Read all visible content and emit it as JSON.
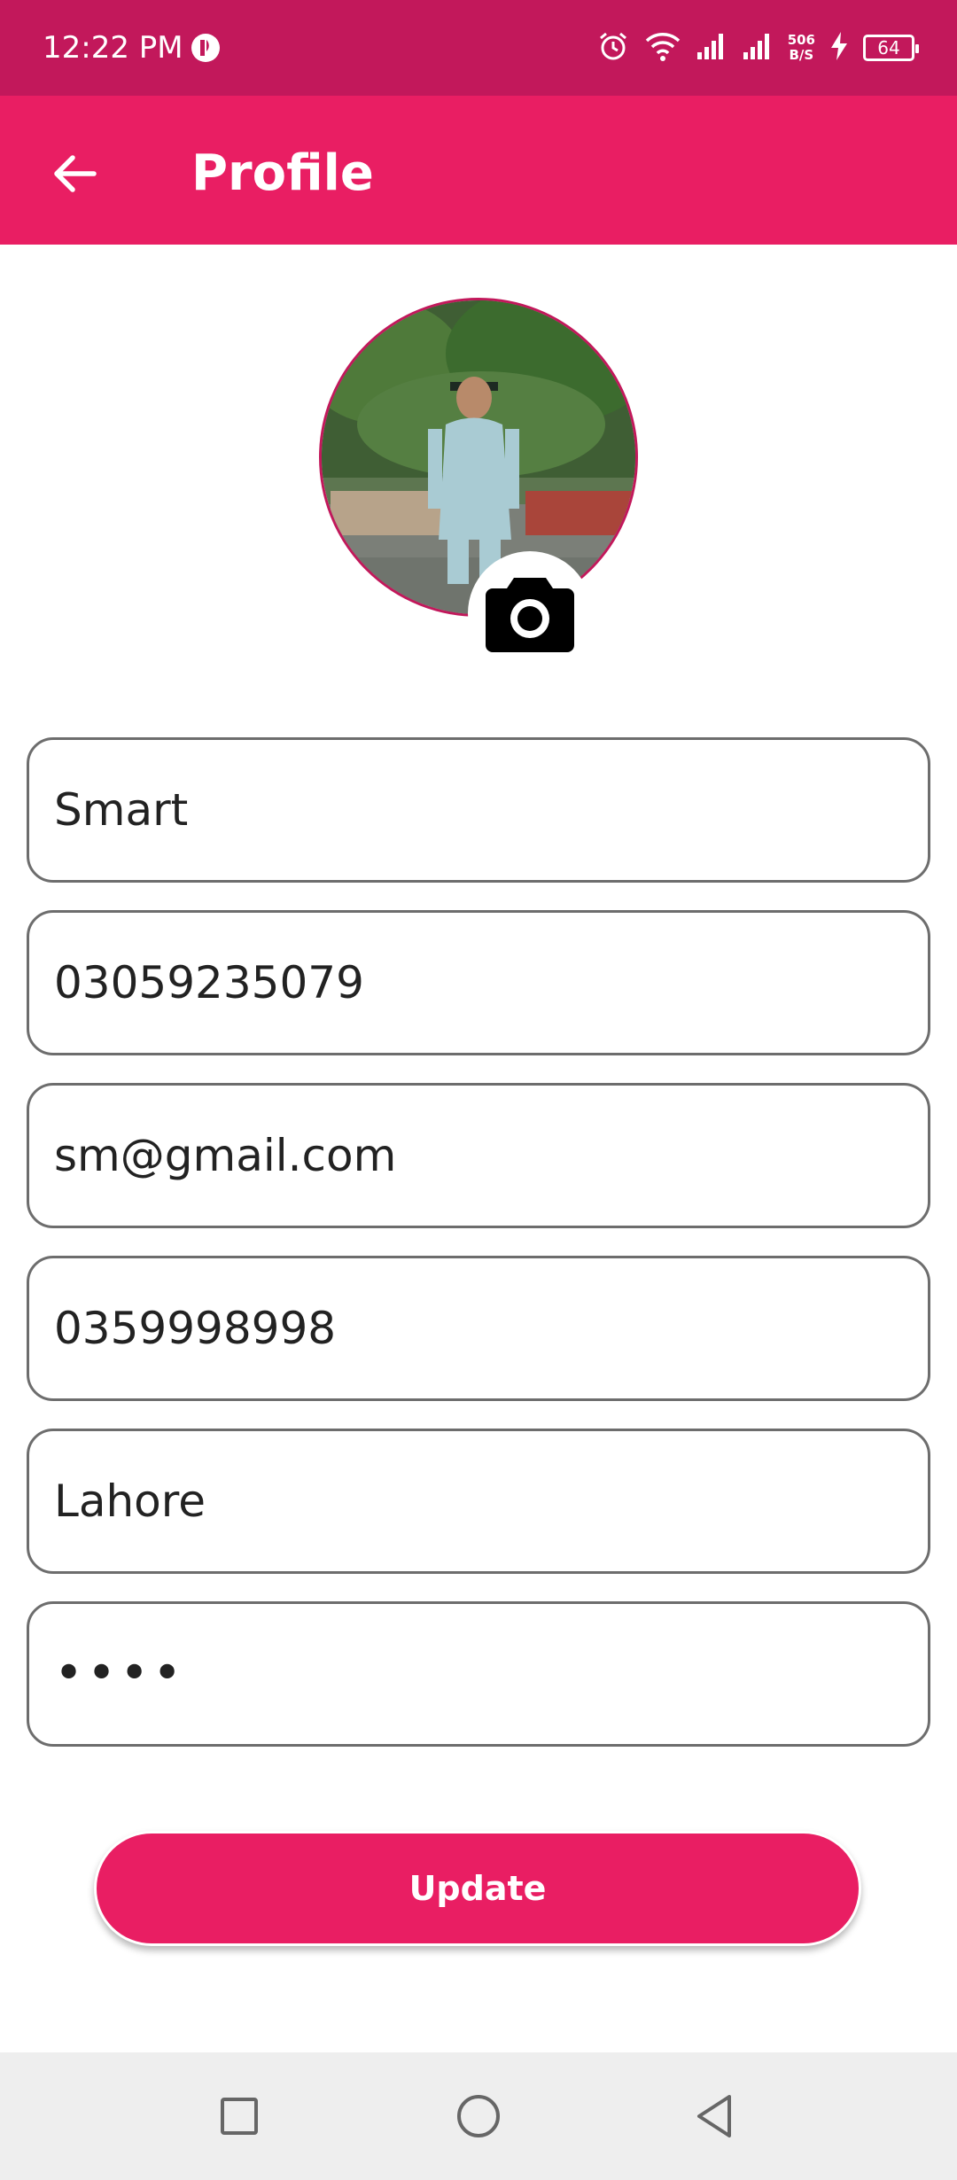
{
  "status_bar": {
    "time": "12:22 PM",
    "net_speed_value": "506",
    "net_speed_unit": "B/S",
    "battery": "64",
    "icons": [
      "app-notification-icon",
      "alarm-icon",
      "wifi-icon",
      "signal-icon",
      "signal-icon",
      "charging-icon",
      "battery-icon"
    ]
  },
  "app_bar": {
    "title": "Profile",
    "back_icon": "arrow-left-icon"
  },
  "profile": {
    "avatar_icon": "person-photo",
    "camera_icon": "camera-icon"
  },
  "form": {
    "name": "Smart",
    "phone": "03059235079",
    "email": "sm@gmail.com",
    "alt_phone": "0359998998",
    "city": "Lahore",
    "password_mask": "••••"
  },
  "actions": {
    "update_label": "Update"
  },
  "nav": {
    "icons": [
      "recent-apps-icon",
      "home-icon",
      "back-triangle-icon"
    ]
  },
  "colors": {
    "status_bar": "#c2185b",
    "app_bar": "#e91e63",
    "accent": "#e91e63",
    "field_border": "#6d6d6d"
  }
}
